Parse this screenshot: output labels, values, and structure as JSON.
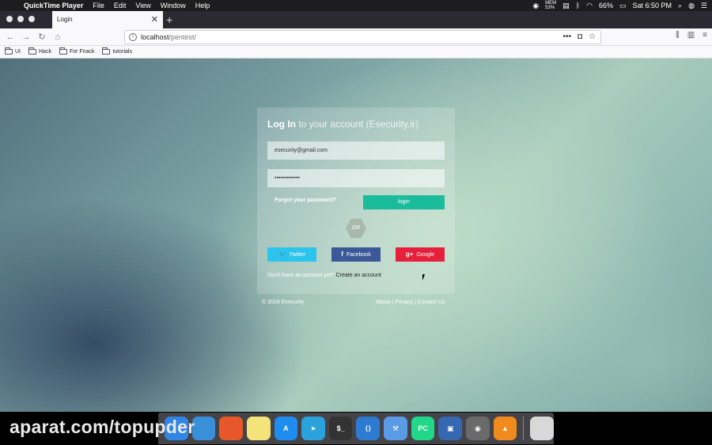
{
  "menubar": {
    "app_name": "QuickTime Player",
    "menus": [
      "File",
      "Edit",
      "View",
      "Window",
      "Help"
    ],
    "battery": "66%",
    "clock": "Sat 6:50 PM",
    "mem": "MEM\n53%"
  },
  "browser": {
    "tab_title": "Login",
    "url_host": "localhost",
    "url_path": "/pentest/",
    "bookmarks": [
      "UI",
      "Hack",
      "For Fnack",
      "tutorials"
    ]
  },
  "login": {
    "title_bold": "Log In",
    "title_rest": " to your account (Esecurity.ir)",
    "email_value": "esecurity@gmail.com",
    "password_value": "•••••••••••••",
    "forgot_label": "Forgot your password?",
    "login_label": "login",
    "or_label": "OR",
    "twitter_label": "Twitter",
    "facebook_label": "Facebook",
    "google_label": "Google",
    "twitter_glyph": "🐦",
    "facebook_glyph": "f",
    "google_glyph": "g+",
    "signup_text": "Don't have an account yet?",
    "signup_link": "Create an account",
    "colors": {
      "login_button": "#1abc9c",
      "twitter": "#2bc4ed",
      "facebook": "#3b5998",
      "google": "#e6203a"
    }
  },
  "footer": {
    "copyright": "© 2018 Esecurity",
    "about": "About",
    "privacy": "Privacy",
    "contact": "Contact Us",
    "sep": " | "
  },
  "watermark": "aparat.com/topupder",
  "dock": {
    "apps": [
      {
        "name": "finder-icon",
        "label": "",
        "color": "#2f86e6"
      },
      {
        "name": "safari-icon",
        "label": "",
        "color": "#3a8fd9"
      },
      {
        "name": "firefox-icon",
        "label": "",
        "color": "#e8572a"
      },
      {
        "name": "notes-icon",
        "label": "",
        "color": "#f4e27a"
      },
      {
        "name": "app-store-icon",
        "label": "A",
        "color": "#1f8cf0"
      },
      {
        "name": "telegram-icon",
        "label": "➤",
        "color": "#2aa3dd"
      },
      {
        "name": "terminal-icon",
        "label": "$_",
        "color": "#333333"
      },
      {
        "name": "vscode-icon",
        "label": "⟨⟩",
        "color": "#2c7bd1"
      },
      {
        "name": "xcode-icon",
        "label": "⚒",
        "color": "#5a9be6"
      },
      {
        "name": "pycharm-icon",
        "label": "PC",
        "color": "#21d789"
      },
      {
        "name": "virtualbox-icon",
        "label": "▣",
        "color": "#3667b1"
      },
      {
        "name": "chrome-icon",
        "label": "◉",
        "color": "#6a6a6a"
      },
      {
        "name": "vlc-icon",
        "label": "▲",
        "color": "#f08a1c"
      }
    ],
    "trash": {
      "name": "trash-icon",
      "label": "",
      "color": "#d8d8d8"
    }
  }
}
